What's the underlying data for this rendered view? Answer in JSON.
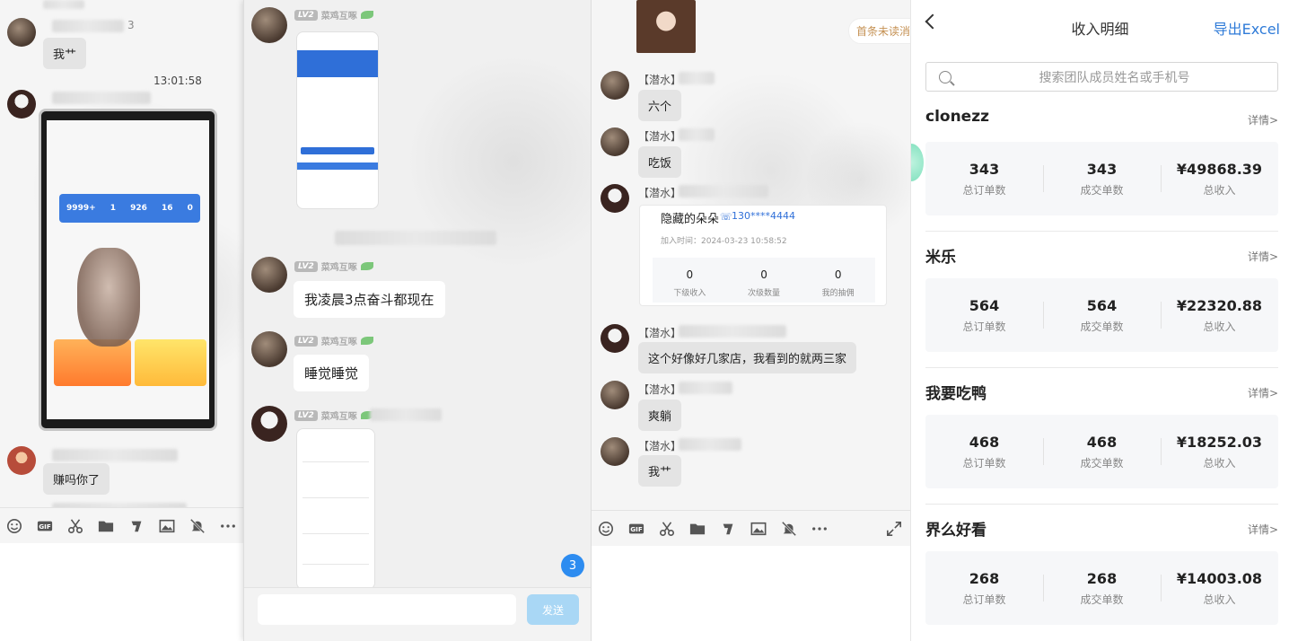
{
  "panel1": {
    "time": "13:01:58",
    "name_fragment": "3",
    "messages": [
      "我艹",
      "赚吗你了"
    ]
  },
  "panel2": {
    "level": "LV2",
    "nickname": "菜鸡互啄",
    "messages": [
      "我凌晨3点奋斗都现在",
      "睡觉睡觉"
    ],
    "send_label": "发送",
    "unread_count": "3"
  },
  "panel3": {
    "unread_hint": "首条未读消",
    "role_tag": "【潜水】",
    "messages": [
      "六个",
      "吃饭",
      "这个好像好几家店，我看到的就两三家",
      "爽躺",
      "我艹"
    ],
    "card": {
      "name": "隐藏的朵朵",
      "phone": "130****4444",
      "join_time": "加入时间：2024-03-23 10:58:52",
      "stats": [
        {
          "value": "0",
          "label": "下级收入"
        },
        {
          "value": "0",
          "label": "次级数量"
        },
        {
          "value": "0",
          "label": "我的抽佣"
        }
      ]
    }
  },
  "income": {
    "title": "收入明细",
    "export_label": "导出Excel",
    "search_placeholder": "搜索团队成员姓名或手机号",
    "detail_label": "详情>",
    "stat_labels": [
      "总订单数",
      "成交单数",
      "总收入"
    ],
    "members": [
      {
        "name": "clonezz",
        "orders": "343",
        "deals": "343",
        "income": "¥49868.39"
      },
      {
        "name": "米乐",
        "orders": "564",
        "deals": "564",
        "income": "¥22320.88"
      },
      {
        "name": "我要吃鸭",
        "orders": "468",
        "deals": "468",
        "income": "¥18252.03"
      },
      {
        "name": "界么好看",
        "orders": "268",
        "deals": "268",
        "income": "¥14003.08"
      }
    ]
  },
  "colors": {
    "accent": "#2f7bd8",
    "badge": "#2d8cf0",
    "send": "#a9d7f5"
  },
  "icons": [
    "emoji-icon",
    "gif-icon",
    "scissors-icon",
    "folder-icon",
    "music-icon",
    "image-icon",
    "bell-off-icon",
    "more-icon",
    "expand-icon",
    "search-icon",
    "back-icon"
  ]
}
